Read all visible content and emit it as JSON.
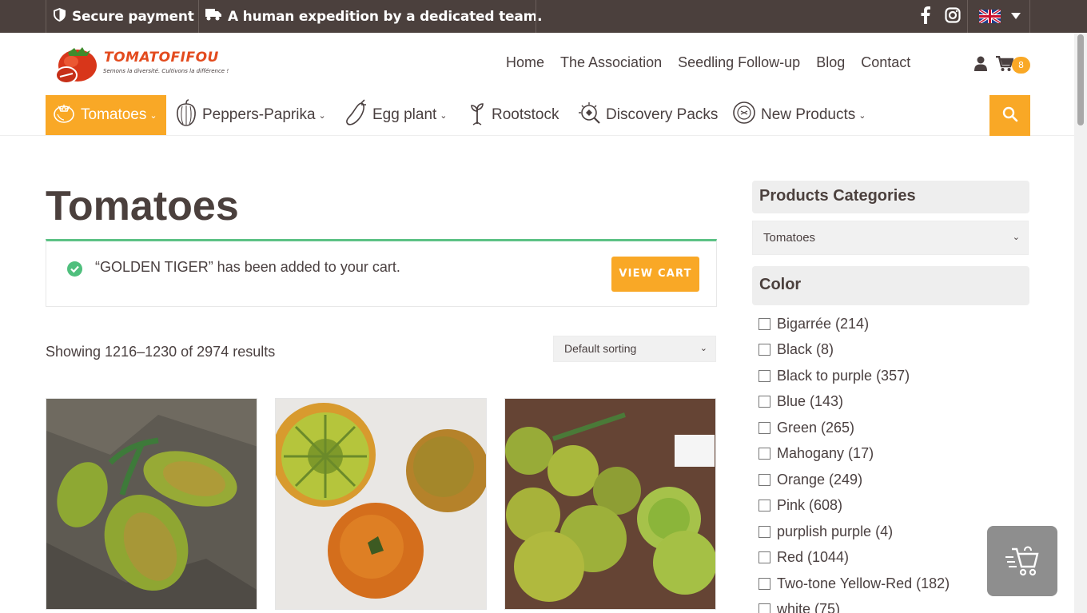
{
  "topbar": {
    "secure": "Secure payment",
    "expedition": "A human expedition by a dedicated team."
  },
  "logo": {
    "name": "TOMATOFIFOU",
    "tagline": "Semons la diversité. Cultivons la différence !"
  },
  "nav": {
    "items": [
      "Home",
      "The Association",
      "Seedling Follow-up",
      "Blog",
      "Contact"
    ],
    "cart_count": "8"
  },
  "categories": [
    {
      "label": "Tomatoes",
      "has_caret": true
    },
    {
      "label": "Peppers-Paprika",
      "has_caret": true
    },
    {
      "label": "Egg plant",
      "has_caret": true
    },
    {
      "label": "Rootstock",
      "has_caret": false
    },
    {
      "label": "Discovery Packs",
      "has_caret": false
    },
    {
      "label": "New Products",
      "has_caret": true
    }
  ],
  "main": {
    "title": "Tomatoes",
    "notice": "“GOLDEN TIGER” has been added to your cart.",
    "view_cart": "VIEW CART",
    "results": "Showing 1216–1230 of 2974 results",
    "sorting": "Default sorting"
  },
  "sidebar": {
    "categories_title": "Products Categories",
    "categories_selected": "Tomatoes",
    "color_title": "Color",
    "colors": [
      "Bigarrée (214)",
      "Black (8)",
      "Black to purple (357)",
      "Blue (143)",
      "Green (265)",
      "Mahogany (17)",
      "Orange (249)",
      "Pink (608)",
      "purplish purple (4)",
      "Red (1044)",
      "Two-tone Yellow-Red (182)",
      "white (75)"
    ]
  },
  "colors": {
    "accent": "#f9a826",
    "topbar": "#4b403d",
    "success": "#5cc285",
    "logo_red": "#e34b1e"
  },
  "icons": {
    "secure": "shield-icon",
    "expedition": "truck-icon",
    "facebook": "facebook-icon",
    "instagram": "instagram-icon",
    "user": "user-icon",
    "cart": "cart-icon",
    "search": "search-icon"
  }
}
